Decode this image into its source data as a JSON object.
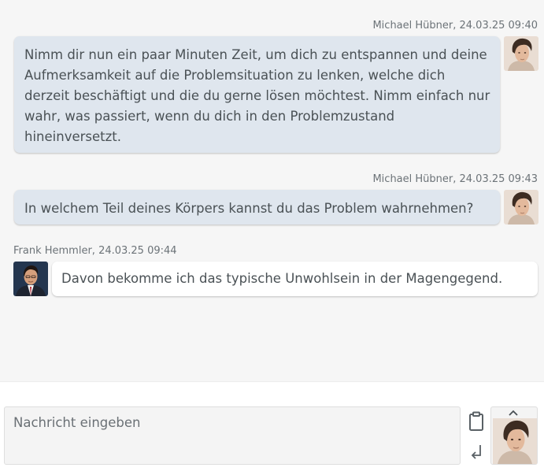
{
  "messages": [
    {
      "direction": "sent",
      "author_meta": "Michael Hübner, 24.03.25 09:40",
      "text": "Nimm dir nun ein paar Minuten Zeit, um dich zu entspannen und deine Aufmerksamkeit auf die Problemsituation zu lenken, welche dich derzeit beschäftigt und die du gerne lösen möchtest. Nimm einfach nur wahr, was passiert, wenn du dich in den Problemzustand hineinversetzt."
    },
    {
      "direction": "sent",
      "author_meta": "Michael Hübner, 24.03.25 09:43",
      "text": "In welchem Teil deines Körpers kannst du das Problem wahrnehmen?"
    },
    {
      "direction": "received",
      "author_meta": "Frank Hemmler, 24.03.25 09:44",
      "text": "Davon bekomme ich das typische Unwohlsein in der Magengegend."
    }
  ],
  "composer": {
    "placeholder": "Nachricht eingeben",
    "value": ""
  },
  "icons": {
    "clipboard": "clipboard-icon",
    "send": "enter-arrow-icon",
    "expand": "chevron-up-icon"
  },
  "colors": {
    "chat_background": "#f6f6f6",
    "sent_bubble": "#dfe6ee",
    "received_bubble": "#ffffff",
    "text": "#4a5155",
    "meta_text": "#6c7378"
  }
}
